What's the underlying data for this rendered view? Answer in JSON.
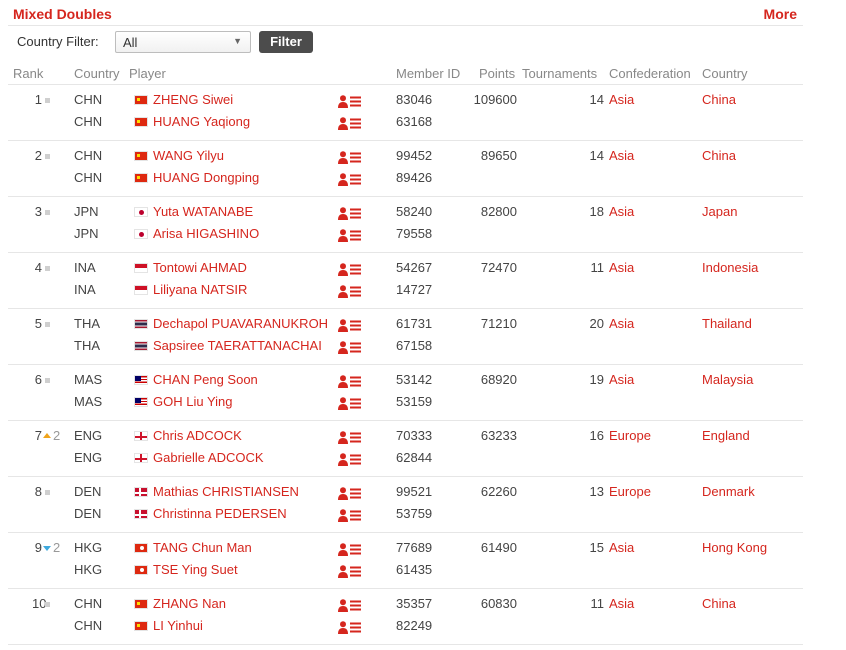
{
  "header": {
    "title": "Mixed Doubles",
    "more_label": "More"
  },
  "filter": {
    "label": "Country Filter:",
    "selected": "All",
    "button_label": "Filter"
  },
  "columns": {
    "rank": "Rank",
    "country": "Country",
    "player": "Player",
    "member_id": "Member ID",
    "points": "Points",
    "tournaments": "Tournaments",
    "confederation": "Confederation",
    "country_name": "Country"
  },
  "rows": [
    {
      "rank": "1",
      "movement": "none",
      "movement_value": "",
      "points": "109600",
      "tournaments": "14",
      "confederation": "Asia",
      "country": "China",
      "flag": "chn",
      "players": [
        {
          "code": "CHN",
          "name": "ZHENG Siwei",
          "member_id": "83046"
        },
        {
          "code": "CHN",
          "name": "HUANG Yaqiong",
          "member_id": "63168"
        }
      ]
    },
    {
      "rank": "2",
      "movement": "none",
      "movement_value": "",
      "points": "89650",
      "tournaments": "14",
      "confederation": "Asia",
      "country": "China",
      "flag": "chn",
      "players": [
        {
          "code": "CHN",
          "name": "WANG Yilyu",
          "member_id": "99452"
        },
        {
          "code": "CHN",
          "name": "HUANG Dongping",
          "member_id": "89426"
        }
      ]
    },
    {
      "rank": "3",
      "movement": "none",
      "movement_value": "",
      "points": "82800",
      "tournaments": "18",
      "confederation": "Asia",
      "country": "Japan",
      "flag": "jpn",
      "players": [
        {
          "code": "JPN",
          "name": "Yuta WATANABE",
          "member_id": "58240"
        },
        {
          "code": "JPN",
          "name": "Arisa HIGASHINO",
          "member_id": "79558"
        }
      ]
    },
    {
      "rank": "4",
      "movement": "none",
      "movement_value": "",
      "points": "72470",
      "tournaments": "11",
      "confederation": "Asia",
      "country": "Indonesia",
      "flag": "ina",
      "players": [
        {
          "code": "INA",
          "name": "Tontowi AHMAD",
          "member_id": "54267"
        },
        {
          "code": "INA",
          "name": "Liliyana NATSIR",
          "member_id": "14727"
        }
      ]
    },
    {
      "rank": "5",
      "movement": "none",
      "movement_value": "",
      "points": "71210",
      "tournaments": "20",
      "confederation": "Asia",
      "country": "Thailand",
      "flag": "tha",
      "players": [
        {
          "code": "THA",
          "name": "Dechapol PUAVARANUKROH",
          "member_id": "61731"
        },
        {
          "code": "THA",
          "name": "Sapsiree TAERATTANACHAI",
          "member_id": "67158"
        }
      ]
    },
    {
      "rank": "6",
      "movement": "none",
      "movement_value": "",
      "points": "68920",
      "tournaments": "19",
      "confederation": "Asia",
      "country": "Malaysia",
      "flag": "mas",
      "players": [
        {
          "code": "MAS",
          "name": "CHAN Peng Soon",
          "member_id": "53142"
        },
        {
          "code": "MAS",
          "name": "GOH Liu Ying",
          "member_id": "53159"
        }
      ]
    },
    {
      "rank": "7",
      "movement": "up",
      "movement_value": "2",
      "points": "63233",
      "tournaments": "16",
      "confederation": "Europe",
      "country": "England",
      "flag": "eng",
      "players": [
        {
          "code": "ENG",
          "name": "Chris ADCOCK",
          "member_id": "70333"
        },
        {
          "code": "ENG",
          "name": "Gabrielle ADCOCK",
          "member_id": "62844"
        }
      ]
    },
    {
      "rank": "8",
      "movement": "none",
      "movement_value": "",
      "points": "62260",
      "tournaments": "13",
      "confederation": "Europe",
      "country": "Denmark",
      "flag": "den",
      "players": [
        {
          "code": "DEN",
          "name": "Mathias CHRISTIANSEN",
          "member_id": "99521"
        },
        {
          "code": "DEN",
          "name": "Christinna PEDERSEN",
          "member_id": "53759"
        }
      ]
    },
    {
      "rank": "9",
      "movement": "down",
      "movement_value": "2",
      "points": "61490",
      "tournaments": "15",
      "confederation": "Asia",
      "country": "Hong Kong",
      "flag": "hkg",
      "players": [
        {
          "code": "HKG",
          "name": "TANG Chun Man",
          "member_id": "77689"
        },
        {
          "code": "HKG",
          "name": "TSE Ying Suet",
          "member_id": "61435"
        }
      ]
    },
    {
      "rank": "10",
      "movement": "none",
      "movement_value": "",
      "points": "60830",
      "tournaments": "11",
      "confederation": "Asia",
      "country": "China",
      "flag": "chn",
      "players": [
        {
          "code": "CHN",
          "name": "ZHANG Nan",
          "member_id": "35357"
        },
        {
          "code": "CHN",
          "name": "LI Yinhui",
          "member_id": "82249"
        }
      ]
    }
  ],
  "colors": {
    "accent": "#d5261e",
    "button": "#4c4c4c",
    "up_arrow": "#f0a41c",
    "down_arrow": "#3fa9dd"
  },
  "icons": {
    "profile": "player-profile-icon",
    "dropdown": "chevron-down-icon"
  }
}
